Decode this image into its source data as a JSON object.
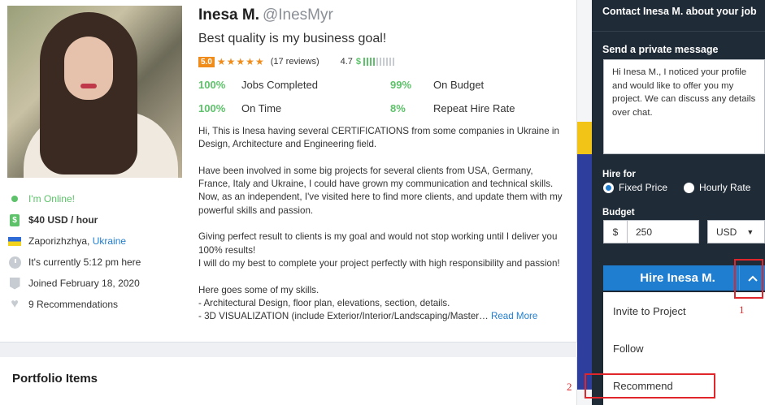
{
  "profile": {
    "name": "Inesa M.",
    "handle": "@InesMyr",
    "tagline": "Best quality is my business goal!",
    "rating": "5.0",
    "stars": "★★★★★",
    "reviews": "(17 reviews)",
    "earnings_score": "4.7",
    "earnings_symbol": "$",
    "earnings_level": 0.4
  },
  "stats": [
    {
      "pct": "100%",
      "label": "Jobs Completed"
    },
    {
      "pct": "99%",
      "label": "On Budget"
    },
    {
      "pct": "100%",
      "label": "On Time"
    },
    {
      "pct": "8%",
      "label": "Repeat Hire Rate"
    }
  ],
  "side_info": {
    "online": "I'm Online!",
    "rate": "$40 USD / hour",
    "city": "Zaporizhzhya,",
    "country": "Ukraine",
    "local_time": "It's currently 5:12 pm here",
    "joined": "Joined February 18, 2020",
    "recommendations": "9 Recommendations"
  },
  "bio": {
    "p1": "Hi, This is Inesa having several CERTIFICATIONS from some companies in Ukraine in Design, Architecture and Engineering field.",
    "p2": "Have been involved in some big projects for several clients from USA, Germany, France, Italy and Ukraine, I could have grown my communication and technical skills.\nNow, as an independent, I've visited here to find more clients, and update them with my powerful skills and passion.",
    "p3": "Giving perfect result to clients is my goal and would not stop working until I deliver you 100% results!\nI will do my best to complete your project perfectly with high responsibility and passion!",
    "p4": "Here goes some of my skills.\n- Architectural Design, floor plan, elevations, section, details.\n- 3D VISUALIZATION (include Exterior/Interior/Landscaping/Master…",
    "read_more": "Read More"
  },
  "portfolio": {
    "title": "Portfolio Items"
  },
  "contact": {
    "title": "Contact Inesa M. about your job",
    "pm_label": "Send a private message",
    "message": "Hi Inesa M., I noticed your profile and would like to offer you my project. We can discuss any details over chat.",
    "hire_for_label": "Hire for",
    "fixed_price": "Fixed Price",
    "hourly_rate": "Hourly Rate",
    "budget_label": "Budget",
    "currency_symbol": "$",
    "budget_value": "250",
    "currency": "USD",
    "hire_button": "Hire Inesa M.",
    "toggle_icon": "^"
  },
  "dropdown": [
    "Invite to Project",
    "Follow",
    "Recommend"
  ],
  "annotations": {
    "one": "1",
    "two": "2"
  },
  "colors": {
    "accent": "#1f7ed0",
    "online": "#5dc26a",
    "rating": "#f08c1c",
    "panel": "#1f2b37",
    "annotation": "#e0262a"
  }
}
